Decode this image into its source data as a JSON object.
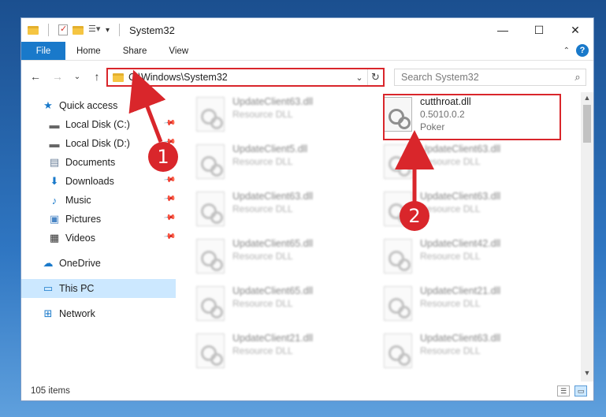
{
  "window": {
    "title": "System32",
    "controls": {
      "minimize": "—",
      "maximize": "☐",
      "close": "✕"
    }
  },
  "ribbon": {
    "tabs": [
      "File",
      "Home",
      "Share",
      "View"
    ],
    "help": "?"
  },
  "navigation": {
    "back": "←",
    "forward": "→",
    "recent": "⌄",
    "up": "↑",
    "address": "C:\\Windows\\System32",
    "search_placeholder": "Search System32"
  },
  "sidebar": {
    "quick_access": "Quick access",
    "items": [
      {
        "label": "Local Disk (C:)",
        "pinned": true
      },
      {
        "label": "Local Disk (D:)",
        "pinned": true
      },
      {
        "label": "Documents",
        "pinned": true
      },
      {
        "label": "Downloads",
        "pinned": true
      },
      {
        "label": "Music",
        "pinned": true
      },
      {
        "label": "Pictures",
        "pinned": true
      },
      {
        "label": "Videos",
        "pinned": true
      }
    ],
    "onedrive": "OneDrive",
    "this_pc": "This PC",
    "network": "Network"
  },
  "files": {
    "highlighted": {
      "name": "cutthroat.dll",
      "version": "0.5010.0.2",
      "company": "Poker"
    },
    "blurred_left": [
      {
        "name": "UpdateClient63.dll",
        "desc": "Resource DLL"
      },
      {
        "name": "UpdateClient5.dll",
        "desc": "Resource DLL"
      },
      {
        "name": "UpdateClient63.dll",
        "desc": "Resource DLL"
      },
      {
        "name": "UpdateClient65.dll",
        "desc": "Resource DLL"
      },
      {
        "name": "UpdateClient65.dll",
        "desc": "Resource DLL"
      },
      {
        "name": "UpdateClient21.dll",
        "desc": "Resource DLL"
      }
    ],
    "blurred_right": [
      {
        "name": "UpdateClient63.dll",
        "desc": "Resource DLL"
      },
      {
        "name": "UpdateClient63.dll",
        "desc": "Resource DLL"
      },
      {
        "name": "UpdateClient42.dll",
        "desc": "Resource DLL"
      },
      {
        "name": "UpdateClient21.dll",
        "desc": "Resource DLL"
      },
      {
        "name": "UpdateClient63.dll",
        "desc": "Resource DLL"
      }
    ]
  },
  "callouts": {
    "one": "1",
    "two": "2"
  },
  "status": {
    "item_count": "105 items"
  },
  "colors": {
    "accent": "#1979ca",
    "annotation": "#d9262b",
    "selected": "#cce8ff"
  }
}
